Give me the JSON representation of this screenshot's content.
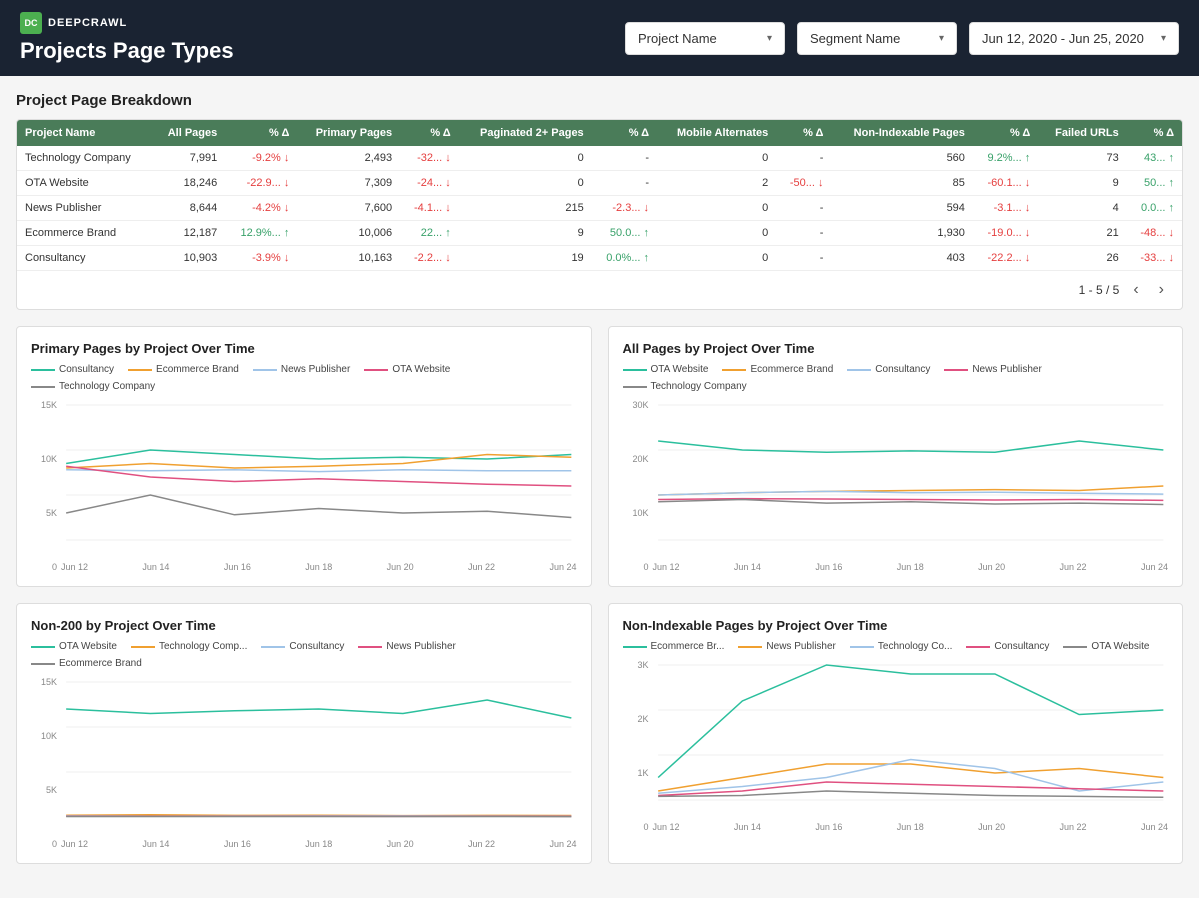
{
  "header": {
    "logo_text": "DEEPCRAWL",
    "page_title": "Projects Page Types",
    "dropdowns": [
      {
        "label": "Project Name",
        "id": "project-name-dropdown"
      },
      {
        "label": "Segment Name",
        "id": "segment-name-dropdown"
      },
      {
        "label": "Jun 12, 2020 - Jun 25, 2020",
        "id": "date-range-dropdown"
      }
    ]
  },
  "table": {
    "section_title": "Project Page Breakdown",
    "columns": [
      "Project Name",
      "All Pages",
      "% Δ",
      "Primary Pages",
      "% Δ",
      "Paginated 2+ Pages",
      "% Δ",
      "Mobile Alternates",
      "% Δ",
      "Non-Indexable Pages",
      "% Δ",
      "Failed URLs",
      "% Δ"
    ],
    "rows": [
      {
        "name": "Technology Company",
        "all_pages": "7,991",
        "all_pct": "-9.2%",
        "all_pct_dir": "down",
        "primary": "2,493",
        "primary_pct": "-32...",
        "primary_pct_dir": "down",
        "pag": "0",
        "pag_pct": "-",
        "mob": "0",
        "mob_pct": "-",
        "nonidx": "560",
        "nonidx_pct": "9.2%...",
        "nonidx_pct_dir": "up",
        "failed": "73",
        "failed_pct": "43...",
        "failed_pct_dir": "up"
      },
      {
        "name": "OTA Website",
        "all_pages": "18,246",
        "all_pct": "-22.9...",
        "all_pct_dir": "down",
        "primary": "7,309",
        "primary_pct": "-24...",
        "primary_pct_dir": "down",
        "pag": "0",
        "pag_pct": "-",
        "mob": "2",
        "mob_pct": "-50...",
        "mob_pct_dir": "down",
        "nonidx": "85",
        "nonidx_pct": "-60.1...",
        "nonidx_pct_dir": "down",
        "failed": "9",
        "failed_pct": "50...",
        "failed_pct_dir": "up"
      },
      {
        "name": "News Publisher",
        "all_pages": "8,644",
        "all_pct": "-4.2%",
        "all_pct_dir": "down",
        "primary": "7,600",
        "primary_pct": "-4.1...",
        "primary_pct_dir": "down",
        "pag": "215",
        "pag_pct": "-2.3...",
        "pag_pct_dir": "down",
        "mob": "0",
        "mob_pct": "-",
        "nonidx": "594",
        "nonidx_pct": "-3.1...",
        "nonidx_pct_dir": "down",
        "failed": "4",
        "failed_pct": "0.0...",
        "failed_pct_dir": "up"
      },
      {
        "name": "Ecommerce Brand",
        "all_pages": "12,187",
        "all_pct": "12.9%...",
        "all_pct_dir": "up",
        "primary": "10,006",
        "primary_pct": "22...",
        "primary_pct_dir": "up",
        "pag": "9",
        "pag_pct": "50.0...",
        "pag_pct_dir": "up",
        "mob": "0",
        "mob_pct": "-",
        "nonidx": "1,930",
        "nonidx_pct": "-19.0...",
        "nonidx_pct_dir": "down",
        "failed": "21",
        "failed_pct": "-48...",
        "failed_pct_dir": "down"
      },
      {
        "name": "Consultancy",
        "all_pages": "10,903",
        "all_pct": "-3.9%",
        "all_pct_dir": "down",
        "primary": "10,163",
        "primary_pct": "-2.2...",
        "primary_pct_dir": "down",
        "pag": "19",
        "pag_pct": "0.0%...",
        "pag_pct_dir": "up",
        "mob": "0",
        "mob_pct": "-",
        "nonidx": "403",
        "nonidx_pct": "-22.2...",
        "nonidx_pct_dir": "down",
        "failed": "26",
        "failed_pct": "-33...",
        "failed_pct_dir": "down"
      }
    ],
    "pagination": "1 - 5 / 5"
  },
  "charts": {
    "primary_pages": {
      "title": "Primary Pages by Project Over Time",
      "legend": [
        {
          "label": "Consultancy",
          "color": "#2bbf9d"
        },
        {
          "label": "Ecommerce Brand",
          "color": "#f0a030"
        },
        {
          "label": "News Publisher",
          "color": "#a0c4e8"
        },
        {
          "label": "OTA Website",
          "color": "#e05080"
        },
        {
          "label": "Technology Company",
          "color": "#888"
        }
      ],
      "x_labels": [
        "Jun 12",
        "Jun 14",
        "Jun 16",
        "Jun 18",
        "Jun 20",
        "Jun 22",
        "Jun 24"
      ],
      "y_labels": [
        "15K",
        "10K",
        "5K",
        "0"
      ],
      "series": {
        "consultancy": [
          8500,
          10000,
          9500,
          9000,
          9200,
          9000,
          9500
        ],
        "ecommerce": [
          8000,
          8500,
          8000,
          8200,
          8500,
          9500,
          9200
        ],
        "news": [
          7800,
          7700,
          7800,
          7600,
          7800,
          7700,
          7700
        ],
        "ota": [
          8200,
          7000,
          6500,
          6800,
          6500,
          6200,
          6000
        ],
        "tech": [
          3000,
          5000,
          2800,
          3500,
          3000,
          3200,
          2500
        ]
      }
    },
    "all_pages": {
      "title": "All Pages by Project Over Time",
      "legend": [
        {
          "label": "OTA Website",
          "color": "#2bbf9d"
        },
        {
          "label": "Ecommerce Brand",
          "color": "#f0a030"
        },
        {
          "label": "Consultancy",
          "color": "#a0c4e8"
        },
        {
          "label": "News Publisher",
          "color": "#e05080"
        },
        {
          "label": "Technology Company",
          "color": "#888"
        }
      ],
      "x_labels": [
        "Jun 12",
        "Jun 14",
        "Jun 16",
        "Jun 18",
        "Jun 20",
        "Jun 22",
        "Jun 24"
      ],
      "y_labels": [
        "30K",
        "20K",
        "10K",
        "0"
      ],
      "series": {
        "ota": [
          22000,
          20000,
          19500,
          19800,
          19500,
          22000,
          20000
        ],
        "ecommerce": [
          10000,
          10500,
          10800,
          11000,
          11200,
          11000,
          12000
        ],
        "consultancy": [
          10000,
          10500,
          10800,
          10500,
          10600,
          10400,
          10200
        ],
        "news": [
          9000,
          9200,
          9100,
          9000,
          8900,
          9000,
          8800
        ],
        "tech": [
          8500,
          9000,
          8200,
          8500,
          8000,
          8200,
          7900
        ]
      }
    },
    "non200": {
      "title": "Non-200 by Project Over Time",
      "legend": [
        {
          "label": "OTA Website",
          "color": "#2bbf9d"
        },
        {
          "label": "Technology Comp...",
          "color": "#f0a030"
        },
        {
          "label": "Consultancy",
          "color": "#a0c4e8"
        },
        {
          "label": "News Publisher",
          "color": "#e05080"
        },
        {
          "label": "Ecommerce Brand",
          "color": "#888"
        }
      ],
      "x_labels": [
        "Jun 12",
        "Jun 14",
        "Jun 16",
        "Jun 18",
        "Jun 20",
        "Jun 22",
        "Jun 24"
      ],
      "y_labels": [
        "15K",
        "10K",
        "5K",
        "0"
      ],
      "series": {
        "ota": [
          12000,
          11500,
          11800,
          12000,
          11500,
          13000,
          11000
        ],
        "tech": [
          200,
          250,
          180,
          200,
          150,
          180,
          160
        ],
        "consultancy": [
          120,
          100,
          110,
          130,
          120,
          110,
          100
        ],
        "news": [
          80,
          90,
          85,
          80,
          75,
          80,
          70
        ],
        "ecommerce": [
          50,
          60,
          55,
          50,
          55,
          50,
          45
        ]
      }
    },
    "non_indexable": {
      "title": "Non-Indexable Pages by Project Over Time",
      "legend": [
        {
          "label": "Ecommerce Br...",
          "color": "#2bbf9d"
        },
        {
          "label": "News Publisher",
          "color": "#f0a030"
        },
        {
          "label": "Technology Co...",
          "color": "#a0c4e8"
        },
        {
          "label": "Consultancy",
          "color": "#e05080"
        },
        {
          "label": "OTA Website",
          "color": "#888"
        }
      ],
      "x_labels": [
        "Jun 12",
        "Jun 14",
        "Jun 16",
        "Jun 18",
        "Jun 20",
        "Jun 22",
        "Jun 24"
      ],
      "y_labels": [
        "3K",
        "2K",
        "1K",
        "0"
      ],
      "series": {
        "ecommerce": [
          500,
          2200,
          3000,
          2800,
          2800,
          1900,
          2000
        ],
        "news": [
          200,
          500,
          800,
          800,
          600,
          700,
          500
        ],
        "tech": [
          150,
          300,
          500,
          900,
          700,
          200,
          400
        ],
        "consultancy": [
          100,
          200,
          400,
          350,
          300,
          250,
          200
        ],
        "ota": [
          80,
          100,
          200,
          150,
          100,
          80,
          60
        ]
      }
    }
  },
  "colors": {
    "header_bg": "#1a2332",
    "table_header_bg": "#4a7c59",
    "accent_green": "#2bbf9d",
    "accent_orange": "#f0a030",
    "accent_blue": "#a0c4e8",
    "accent_pink": "#e05080",
    "accent_gray": "#888"
  }
}
